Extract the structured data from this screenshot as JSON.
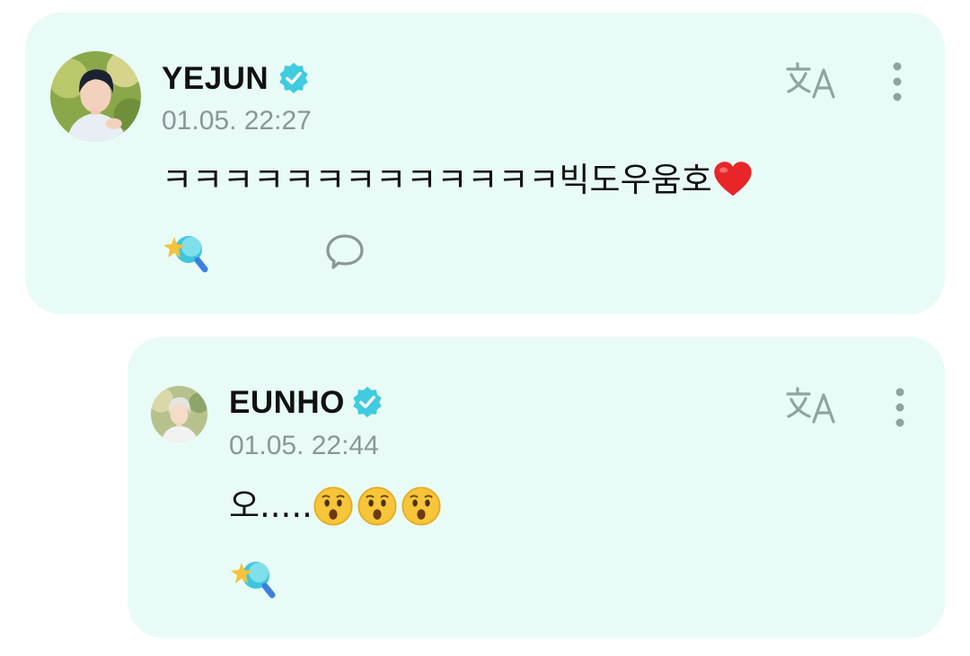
{
  "comments": [
    {
      "author": "YEJUN",
      "timestamp": "01.05. 22:27",
      "text": "ㅋㅋㅋㅋㅋㅋㅋㅋㅋㅋㅋㅋㅋ빅도우움호"
    },
    {
      "author": "EUNHO",
      "timestamp": "01.05. 22:44",
      "text": "오....."
    }
  ],
  "icons": {
    "verified": "verified-badge-icon",
    "translate": "translate-icon",
    "more": "more-vertical-icon",
    "reaction": "star-wand-reaction-icon",
    "reply": "speech-bubble-icon",
    "heart": "red-heart-emoji",
    "surprised": "surprised-face-emoji"
  },
  "colors": {
    "card_background": "#e8fbf7",
    "verified": "#3fcbe0",
    "muted": "#8a9794"
  }
}
